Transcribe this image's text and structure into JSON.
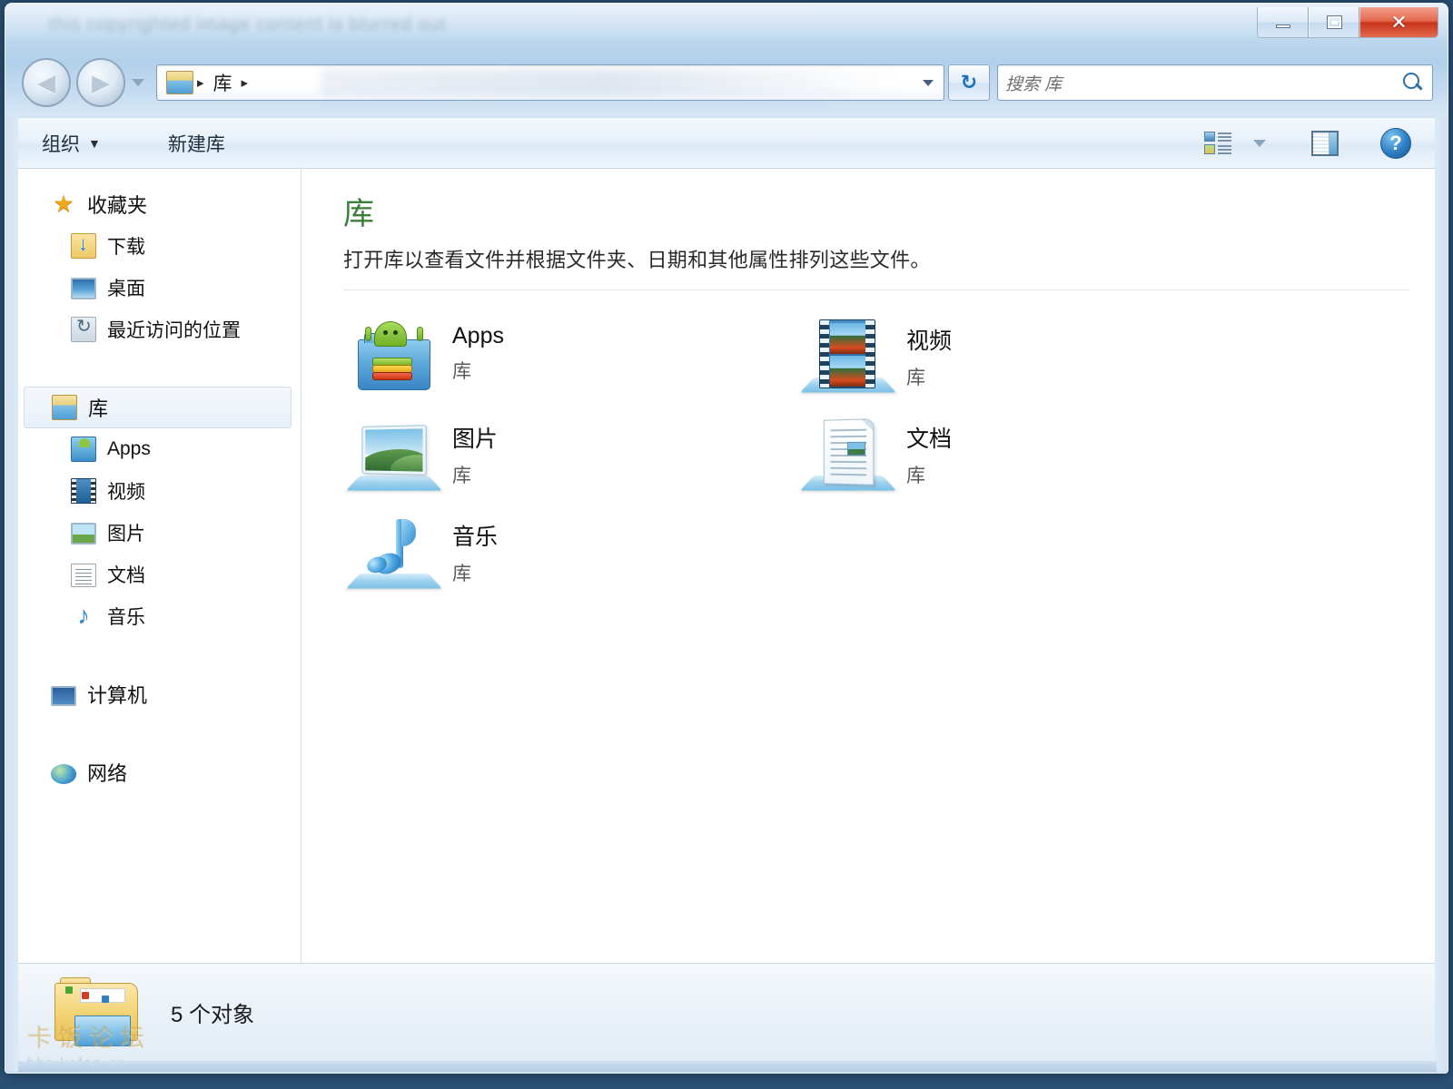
{
  "window": {
    "title_blurred": "this copyrighted image content is blurred out",
    "controls": {
      "minimize": "Minimize",
      "restore": "Restore",
      "close": "Close"
    }
  },
  "nav": {
    "back": "◀",
    "forward": "▶",
    "history_label": "Recent pages",
    "refresh_label": "↻",
    "breadcrumb": [
      "库"
    ],
    "separator": "▸",
    "dropdown_label": "Previous locations"
  },
  "search": {
    "placeholder": "搜索 库",
    "icon": "search-icon"
  },
  "toolbar": {
    "organize_label": "组织",
    "organize_caret": "▼",
    "new_library_label": "新建库",
    "view_icon": "view-options-icon",
    "view_caret": "▼",
    "preview_pane_icon": "preview-pane-icon",
    "help_icon": "?",
    "help_label": "帮助"
  },
  "sidebar": {
    "groups": [
      {
        "name": "favorites",
        "header": {
          "label": "收藏夹",
          "icon": "star-icon"
        },
        "items": [
          {
            "label": "下载",
            "icon": "downloads-icon"
          },
          {
            "label": "桌面",
            "icon": "desktop-icon"
          },
          {
            "label": "最近访问的位置",
            "icon": "recent-places-icon"
          }
        ]
      },
      {
        "name": "libraries",
        "header": {
          "label": "库",
          "icon": "library-icon",
          "selected": true
        },
        "items": [
          {
            "label": "Apps",
            "icon": "apps-icon"
          },
          {
            "label": "视频",
            "icon": "video-icon"
          },
          {
            "label": "图片",
            "icon": "pictures-icon"
          },
          {
            "label": "文档",
            "icon": "documents-icon"
          },
          {
            "label": "音乐",
            "icon": "music-icon"
          }
        ]
      },
      {
        "name": "computer",
        "header": {
          "label": "计算机",
          "icon": "computer-icon"
        },
        "items": []
      },
      {
        "name": "network",
        "header": {
          "label": "网络",
          "icon": "network-icon"
        },
        "items": []
      }
    ]
  },
  "main": {
    "heading": "库",
    "subheading": "打开库以查看文件并根据文件夹、日期和其他属性排列这些文件。",
    "heading_color": "#3c7d3c",
    "items": [
      {
        "name": "Apps",
        "type": "库",
        "icon": "apps-library-icon"
      },
      {
        "name": "视频",
        "type": "库",
        "icon": "videos-library-icon"
      },
      {
        "name": "图片",
        "type": "库",
        "icon": "pictures-library-icon"
      },
      {
        "name": "文档",
        "type": "库",
        "icon": "documents-library-icon"
      },
      {
        "name": "音乐",
        "type": "库",
        "icon": "music-library-icon"
      }
    ]
  },
  "status": {
    "text": "5 个对象",
    "folder_icon": "folder-group-icon"
  },
  "watermark": {
    "line1": "卡饭论坛",
    "line2": "bbs.kafan.cn"
  }
}
